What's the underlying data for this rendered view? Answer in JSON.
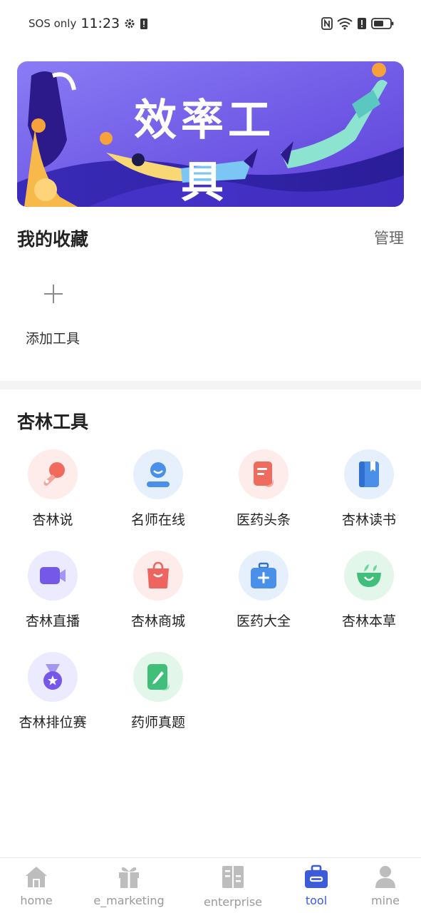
{
  "status_bar": {
    "carrier": "SOS only",
    "time": "11:23",
    "icons": [
      "gear-icon",
      "sim-alert-icon",
      "nfc-icon",
      "wifi-icon",
      "alert-icon",
      "battery-icon"
    ]
  },
  "banner": {
    "title": "效率工具"
  },
  "favorites": {
    "title": "我的收藏",
    "manage_label": "管理",
    "add_tool_label": "添加工具"
  },
  "tools": {
    "title": "杏林工具",
    "items": [
      {
        "label": "杏林说",
        "icon": "microphone-icon",
        "bg": "#fdecea",
        "color": "#f06a5d"
      },
      {
        "label": "名师在线",
        "icon": "teacher-icon",
        "bg": "#e6f0fc",
        "color": "#4a90e8"
      },
      {
        "label": "医药头条",
        "icon": "news-icon",
        "bg": "#fdecea",
        "color": "#ee6b5f"
      },
      {
        "label": "杏林读书",
        "icon": "book-icon",
        "bg": "#e6f0fc",
        "color": "#4a90e8"
      },
      {
        "label": "杏林直播",
        "icon": "video-camera-icon",
        "bg": "#eceaff",
        "color": "#7558e8"
      },
      {
        "label": "杏林商城",
        "icon": "shopping-bag-icon",
        "bg": "#fdecea",
        "color": "#ee6560"
      },
      {
        "label": "医药大全",
        "icon": "medical-kit-icon",
        "bg": "#e6f0fc",
        "color": "#4a90e8"
      },
      {
        "label": "杏林本草",
        "icon": "herb-bowl-icon",
        "bg": "#e2f6ea",
        "color": "#3fbf7a"
      },
      {
        "label": "杏林排位赛",
        "icon": "medal-icon",
        "bg": "#eceaff",
        "color": "#7558e8"
      },
      {
        "label": "药师真题",
        "icon": "exam-paper-icon",
        "bg": "#e2f6ea",
        "color": "#3fbf7a"
      }
    ]
  },
  "tabbar": {
    "active_color": "#3b5bdb",
    "inactive_color": "#bdbdbd",
    "tabs": [
      {
        "label": "home",
        "icon": "home-icon",
        "active": false
      },
      {
        "label": "e_marketing",
        "icon": "gift-icon",
        "active": false
      },
      {
        "label": "enterprise",
        "icon": "enterprise-icon",
        "active": false
      },
      {
        "label": "tool",
        "icon": "toolbox-icon",
        "active": true
      },
      {
        "label": "mine",
        "icon": "person-icon",
        "active": false
      }
    ]
  }
}
